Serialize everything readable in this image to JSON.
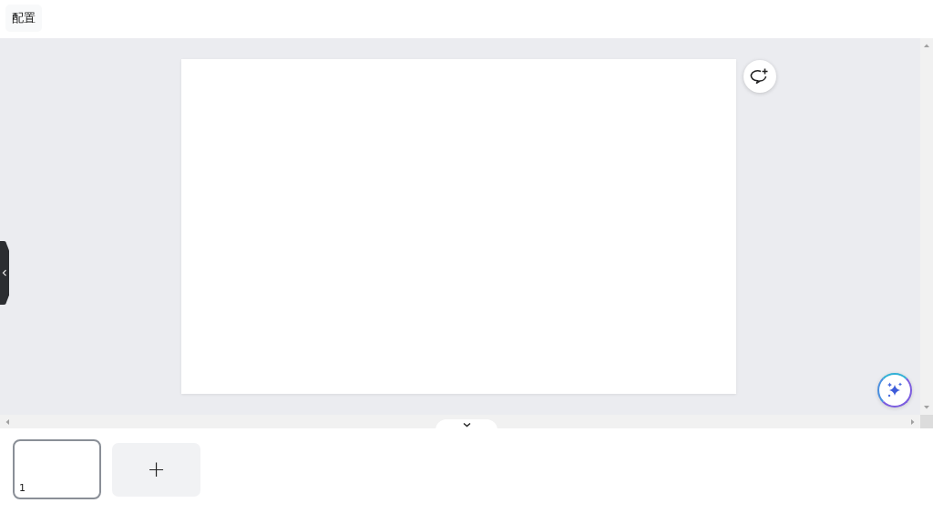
{
  "toolbar": {
    "buttons": [
      {
        "label": "配置"
      }
    ]
  },
  "pages": [
    {
      "number": "1",
      "selected": true
    }
  ],
  "add_page_button": {
    "label": "+"
  }
}
